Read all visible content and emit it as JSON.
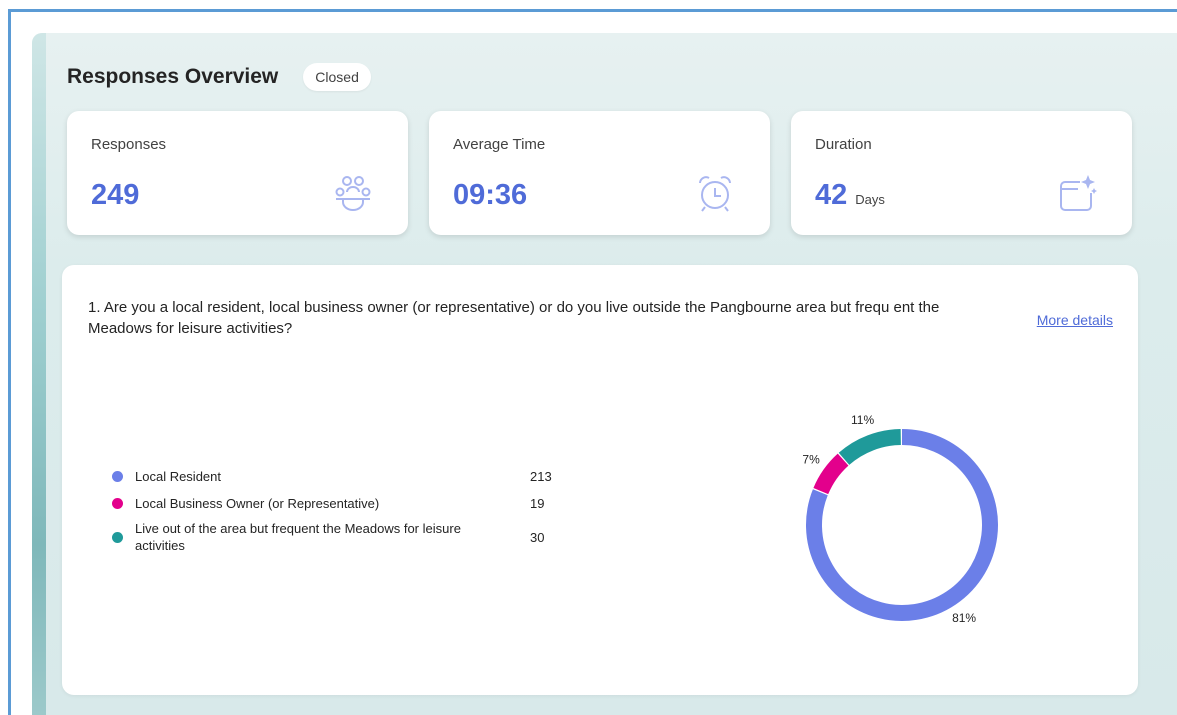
{
  "header": {
    "title": "Responses Overview",
    "status": "Closed"
  },
  "stats": [
    {
      "label": "Responses",
      "value": "249",
      "unit": "",
      "icon": "people-group-icon"
    },
    {
      "label": "Average Time",
      "value": "09:36",
      "unit": "",
      "icon": "alarm-clock-icon"
    },
    {
      "label": "Duration",
      "value": "42",
      "unit": "Days",
      "icon": "calendar-sparkle-icon"
    }
  ],
  "question": {
    "text": "1. Are you a local resident, local business owner (or representative) or do you live outside the Pangbourne area but frequ ent the Meadows for leisure activities?",
    "more_details": "More details"
  },
  "colors": {
    "accent": "#4f6bd8",
    "local_resident": "#6b7fe8",
    "business": "#e3008c",
    "outside": "#1f9a9a"
  },
  "chart_data": {
    "type": "pie",
    "categories": [
      "Local Resident",
      "Local Business Owner (or Representative)",
      "Live out of the area but frequent the Meadows for leisure activities"
    ],
    "values": [
      213,
      19,
      30
    ],
    "percent_labels": [
      "81%",
      "7%",
      "11%"
    ],
    "colors": [
      "#6b7fe8",
      "#e3008c",
      "#1f9a9a"
    ],
    "legend": "left"
  }
}
